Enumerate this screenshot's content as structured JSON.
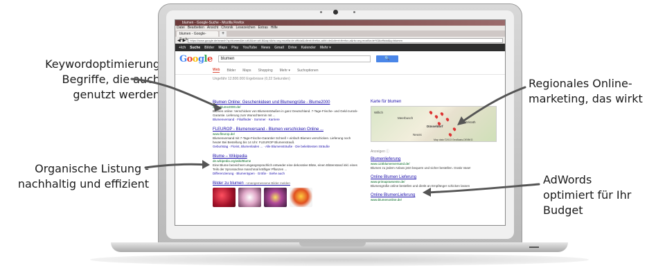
{
  "callouts": {
    "keyword": [
      "Keywordoptimierung",
      "Begriffe, die auch",
      "genutzt werden"
    ],
    "organic": [
      "Organische Listung -",
      "nachhaltig und effizient"
    ],
    "regional": [
      "Regionales Online-",
      "marketing, das wirkt"
    ],
    "adwords": [
      "AdWords",
      "optimiert für Ihr",
      "Budget"
    ]
  },
  "browser": {
    "window_title": "blumen - Google-Suche - Mozilla Firefox",
    "menu": [
      "Datei",
      "Bearbeiten",
      "Ansicht",
      "Chronik",
      "Lesezeichen",
      "Extras",
      "Hilfe"
    ],
    "tab_title": "blumen - Google-Suche",
    "new_tab": "+",
    "url": "https://www.google.de/search?q=blumen&ie=utf-8&oe=utf-8&aq=t&rls=org.mozilla:de:official&client=firefox-a#hl=de&client=firefox-a&rls=org.mozilla:de%3Aofficial&q=blumen"
  },
  "gbar": [
    "+Ich",
    "Suche",
    "Bilder",
    "Maps",
    "Play",
    "YouTube",
    "News",
    "Gmail",
    "Drive",
    "Kalender",
    "Mehr ▾"
  ],
  "search": {
    "logo": "Google",
    "query": "blumen",
    "button": "🔍",
    "tabs": [
      "Web",
      "Bilder",
      "Maps",
      "Shopping",
      "Mehr ▾",
      "Suchoptionen"
    ],
    "stats": "Ungefähr 12.800.000 Ergebnisse (0,22 Sekunden)"
  },
  "results": [
    {
      "title": "Blumen Online: Geschenkideen und Blumengrüße - Blume2000",
      "url": "www.blume2000.de/",
      "snippet": "Blumen online: Verschicken von Blumensträußen in ganz Deutschland. 7-Tage-Frische- und Geld-zurück-Garantie. Lieferung zum Wunschtermin mit ...",
      "links": "Blumenversand · Filialfinder · Sommer · Karriere"
    },
    {
      "title": "FLEUROP - Blumenversand - Blumen verschicken Online ...",
      "url": "www.fleurop.de/",
      "snippet": "Blumenversand mit 7-Tage-Frische-Garantie! Schnell + einfach Blumen verschicken. Lieferung noch heute! Bei Bestellung bis 14 Uhr: FLEUROP Blumenstrauß.",
      "links": "Geburtstag · Florist, Blumenladen ... · Alle Blumensträuße · Die beliebtesten Sträuße"
    },
    {
      "title": "Blume – Wikipedia",
      "url": "de.wikipedia.org/wiki/Blume",
      "snippet": "Eine Blume bezeichnet umgangssprachlich entweder eine dekorative Blüte, einen Blütenstand inkl. eines Teils der Sprossachse manchmal kräftiger Pflanzen ...",
      "links": "Differenzierung · Blumentypen · Größe · Siehe auch"
    }
  ],
  "images_header": "Bilder zu blumen",
  "images_sub": "- Unangemessene Bilder melden",
  "image_colors": [
    "#c0203a",
    "#d8a0b8",
    "#7a2a6a",
    "#e06a20"
  ],
  "map": {
    "title": "Karte für blumen",
    "labels": [
      "Willich",
      "Meerbusch",
      "Düsseldorf",
      "Neuss",
      "Erkrath"
    ],
    "footer": "Map data ©2013 GeoBasis-DE/BKG"
  },
  "ads_label": "Anzeigen ⓘ",
  "ads": [
    {
      "title": "Blumenlieferung",
      "url": "www.123blumenversand.de/",
      "snippet": "Blumen zu jedem Anlass jetzt bequem und sicher bestellen. Gratis Vase!"
    },
    {
      "title": "Online Blumen Lieferung",
      "url": "www.primapraesente.de/",
      "snippet": "Blumengrüße online bestellen und direkt an Empfänger schicken lassen"
    },
    {
      "title": "Online BlumenLieferung",
      "url": "www.blumenonline.de/",
      "snippet": ""
    }
  ]
}
